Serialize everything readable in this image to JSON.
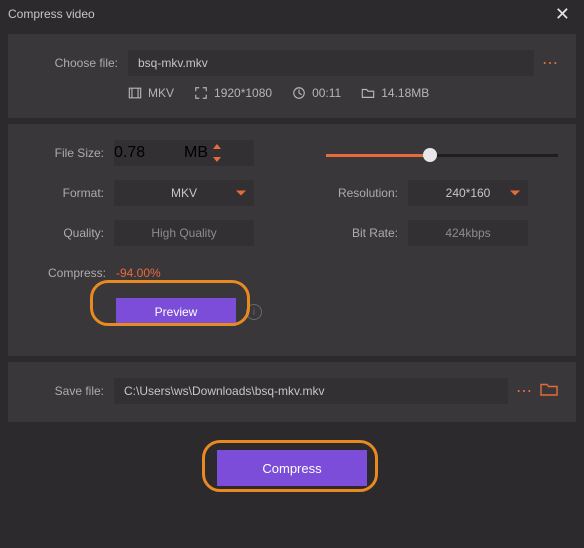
{
  "title": "Compress video",
  "choose_file": {
    "label": "Choose file:",
    "value": "bsq-mkv.mkv"
  },
  "meta": {
    "format_badge": "MKV",
    "resolution": "1920*1080",
    "duration": "00:11",
    "filesize": "14.18MB"
  },
  "filesize": {
    "label": "File Size:",
    "value": "0.78",
    "unit": "MB"
  },
  "format": {
    "label": "Format:",
    "value": "MKV"
  },
  "quality": {
    "label": "Quality:",
    "value": "High Quality"
  },
  "resolution_out": {
    "label": "Resolution:",
    "value": "240*160"
  },
  "bitrate": {
    "label": "Bit Rate:",
    "value": "424kbps"
  },
  "slider_percent": 45,
  "compress": {
    "label": "Compress:",
    "value": "-94.00%"
  },
  "preview_label": "Preview",
  "save_file": {
    "label": "Save file:",
    "value": "C:\\Users\\ws\\Downloads\\bsq-mkv.mkv"
  },
  "compress_button": "Compress"
}
